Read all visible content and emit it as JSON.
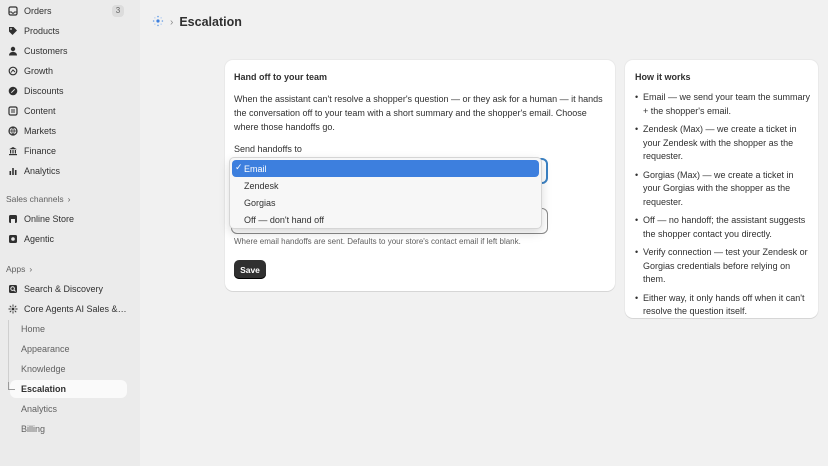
{
  "sidebar": {
    "items": [
      {
        "label": "Orders",
        "icon": "inbox-icon",
        "badge": "3"
      },
      {
        "label": "Products",
        "icon": "tag-icon"
      },
      {
        "label": "Customers",
        "icon": "person-icon"
      },
      {
        "label": "Growth",
        "icon": "growth-icon"
      },
      {
        "label": "Discounts",
        "icon": "discount-icon"
      },
      {
        "label": "Content",
        "icon": "content-icon"
      },
      {
        "label": "Markets",
        "icon": "globe-icon"
      },
      {
        "label": "Finance",
        "icon": "bank-icon"
      },
      {
        "label": "Analytics",
        "icon": "bar-chart-icon"
      }
    ],
    "sales_channels": {
      "header": "Sales channels",
      "items": [
        {
          "label": "Online Store",
          "icon": "store-icon"
        },
        {
          "label": "Agentic",
          "icon": "agentic-icon"
        }
      ]
    },
    "apps": {
      "header": "Apps",
      "items": [
        {
          "label": "Search & Discovery",
          "icon": "search-app-icon"
        },
        {
          "label": "Core Agents AI Sales & S...",
          "icon": "sparkle-icon"
        }
      ],
      "subitems": [
        "Home",
        "Appearance",
        "Knowledge",
        "Escalation",
        "Analytics",
        "Billing"
      ],
      "active_subitem": "Escalation"
    }
  },
  "header": {
    "title": "Escalation",
    "icon": "app-logo-icon"
  },
  "main_card": {
    "title": "Hand off to your team",
    "description": "When the assistant can't resolve a shopper's question — or they ask for a human — it hands the conversation off to your team with a short summary and the shopper's email. Choose where those handoffs go.",
    "field_label": "Send handoffs to",
    "options": [
      "Email",
      "Zendesk",
      "Gorgias",
      "Off — don't hand off"
    ],
    "selected_option": "Email",
    "check_mark": "✓",
    "help_text": "Where email handoffs are sent. Defaults to your store's contact email if left blank.",
    "save_label": "Save"
  },
  "side_card": {
    "title": "How it works",
    "bullets": [
      "Email — we send your team the summary + the shopper's email.",
      "Zendesk (Max) — we create a ticket in your Zendesk with the shopper as the requester.",
      "Gorgias (Max) — we create a ticket in your Gorgias with the shopper as the requester.",
      "Off — no handoff; the assistant suggests the shopper contact you directly.",
      "Verify connection — test your Zendesk or Gorgias credentials before relying on them.",
      "Either way, it only hands off when it can't resolve the question itself."
    ]
  },
  "colors": {
    "accent": "#3d7fde",
    "focus": "#3b82c4",
    "primary_button": "#303030"
  }
}
